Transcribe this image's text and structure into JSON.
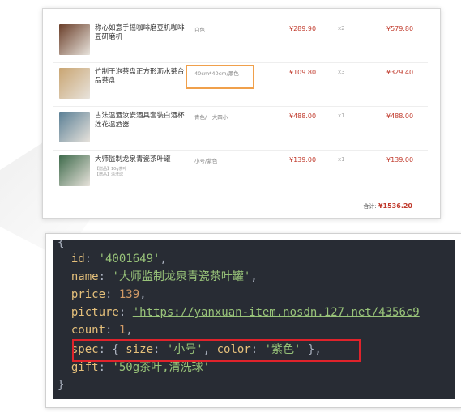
{
  "order_items": [
    {
      "name": "称心如意手摇咖啡磨豆机咖啡豆研磨机",
      "gifts": [],
      "spec": "白色",
      "price": "¥289.90",
      "count": "x2",
      "subtotal": "¥579.80",
      "thumb_color": "#6b3f2a"
    },
    {
      "name": "竹制干泡茶盘正方形沥水茶台品茶盘",
      "gifts": [],
      "spec": "40cm*40cm/黑色",
      "price": "¥109.80",
      "count": "x3",
      "subtotal": "¥329.40",
      "thumb_color": "#c9a572"
    },
    {
      "name": "古法温酒汝瓷酒具套装白酒杯莲花温酒器",
      "gifts": [],
      "spec": "青色/一大四小",
      "price": "¥488.00",
      "count": "x1",
      "subtotal": "¥488.00",
      "thumb_color": "#5a7f95"
    },
    {
      "name": "大师监制龙泉青瓷茶叶罐",
      "gifts": [
        "【赠品】10g茶叶",
        "【赠品】清洗球"
      ],
      "spec": "小号/紫色",
      "price": "¥139.00",
      "count": "x1",
      "subtotal": "¥139.00",
      "thumb_color": "#3f6b4c"
    }
  ],
  "total": {
    "label": "合计:",
    "amount": "¥1536.20"
  },
  "code": {
    "open_brace": "{",
    "id_key": "id",
    "id_value": "'4001649'",
    "name_key": "name",
    "name_value": "'大师监制龙泉青瓷茶叶罐'",
    "price_key": "price",
    "price_value": "139",
    "picture_key": "picture",
    "picture_value": "'https://yanxuan-item.nosdn.127.net/4356c9",
    "count_key": "count",
    "count_value": "1",
    "spec_key": "spec",
    "size_key": "size",
    "size_value": "'小号'",
    "color_key": "color",
    "color_value": "'紫色'",
    "gift_key": "gift",
    "gift_value": "'50g茶叶,清洗球'",
    "close_brace": "}"
  }
}
